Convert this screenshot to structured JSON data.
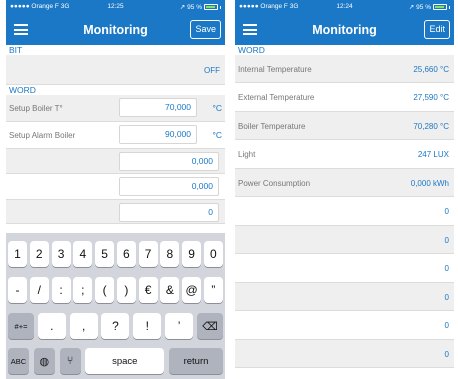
{
  "left_screen": {
    "status": {
      "carrier": "●●●●● Orange F",
      "network": "3G",
      "time": "12:25",
      "location_arrow": "↗",
      "battery": "95 %"
    },
    "nav": {
      "title": "Monitoring",
      "button_label": "Save"
    },
    "bit_section": {
      "header": "BIT",
      "value": "OFF"
    },
    "word_section": {
      "header": "WORD",
      "rows": [
        {
          "label": "Setup Boiler T°",
          "value": "70,000",
          "unit": "°C"
        },
        {
          "label": "Setup Alarm Boiler",
          "value": "90,000",
          "unit": "°C"
        },
        {
          "label": "",
          "value": "0,000",
          "unit": ""
        },
        {
          "label": "",
          "value": "0,000",
          "unit": ""
        },
        {
          "label": "",
          "value": "0",
          "unit": ""
        }
      ]
    },
    "keyboard": {
      "row1": [
        "1",
        "2",
        "3",
        "4",
        "5",
        "6",
        "7",
        "8",
        "9",
        "0"
      ],
      "row2": [
        "-",
        "/",
        ":",
        ";",
        "(",
        ")",
        "€",
        "&",
        "@",
        "”"
      ],
      "row3_mode": "#+=",
      "row3": [
        ".",
        ",",
        "?",
        "!",
        "’"
      ],
      "backspace": "⌫",
      "abc": "ABC",
      "globe": "◍",
      "mic": "⑂",
      "space": "space",
      "return": "return"
    }
  },
  "right_screen": {
    "status": {
      "carrier": "●●●●● Orange F",
      "network": "3G",
      "time": "12:24",
      "location_arrow": "↗",
      "battery": "95 %"
    },
    "nav": {
      "title": "Monitoring",
      "button_label": "Edit"
    },
    "word_section": {
      "header": "WORD",
      "rows": [
        {
          "label": "Internal Temperature",
          "value": "25,660 °C"
        },
        {
          "label": "External Temperature",
          "value": "27,590 °C"
        },
        {
          "label": "Boiler Temperature",
          "value": "70,280 °C"
        },
        {
          "label": "Light",
          "value": "247 LUX"
        },
        {
          "label": "Power Consumption",
          "value": "0,000 kWh"
        },
        {
          "label": "",
          "value": "0"
        },
        {
          "label": "",
          "value": "0"
        },
        {
          "label": "",
          "value": "0"
        },
        {
          "label": "",
          "value": "0"
        },
        {
          "label": "",
          "value": "0"
        },
        {
          "label": "",
          "value": "0"
        }
      ]
    }
  },
  "colors": {
    "accent": "#1a78c6",
    "keyboard_bg": "#d2d5db",
    "row_shade": "#efefef"
  }
}
